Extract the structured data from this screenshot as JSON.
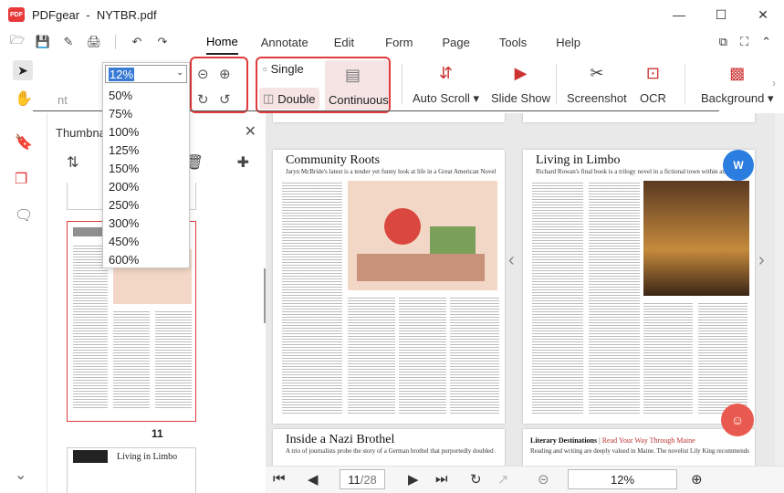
{
  "app": {
    "name": "PDFgear",
    "file": "NYTBR.pdf",
    "logo_text": "PDF"
  },
  "window": {
    "min": "—",
    "max": "☐",
    "close": "✕"
  },
  "menus": [
    "Home",
    "Annotate",
    "Edit",
    "Form",
    "Page",
    "Tools",
    "Help"
  ],
  "active_menu": "Home",
  "toolbar": {
    "single": "Single",
    "double": "Double",
    "continuous": "Continuous",
    "auto_scroll": "Auto Scroll",
    "slide_show": "Slide Show",
    "screenshot": "Screenshot",
    "ocr": "OCR",
    "background": "Background",
    "partial_label": "nt"
  },
  "zoom": {
    "current": "12%",
    "options": [
      "50%",
      "75%",
      "100%",
      "125%",
      "150%",
      "200%",
      "250%",
      "300%",
      "450%",
      "600%"
    ]
  },
  "thumbnails": {
    "header": "Thumbna",
    "page_number": "11"
  },
  "pages": {
    "p1_title": "Community Roots",
    "p1_sub": "Jaryn McBride's latest is a tender yet funny look at life in a Great American Novel",
    "p1_bottom_title": "Inside a Nazi Brothel",
    "p1_bottom_sub": "A trio of journalists probe the story of a German brothel that purportedly doubled as a listening post",
    "p2_title": "Living in Limbo",
    "p2_sub": "Richard Rowan's final book is a trilogy novel in a fictional town within an Italian ...",
    "p2_bottom_title": "Literary Destinations",
    "p2_bottom_tag": "Read Your Way Through Maine",
    "p2_bottom_sub": "Reading and writing are deeply valued in Maine. The novelist Lily King recommends fiction, nature writing, memoirs",
    "thumb_title": "Living in Limbo"
  },
  "pager": {
    "current": "11",
    "total": "/28",
    "zoom": "12%"
  }
}
